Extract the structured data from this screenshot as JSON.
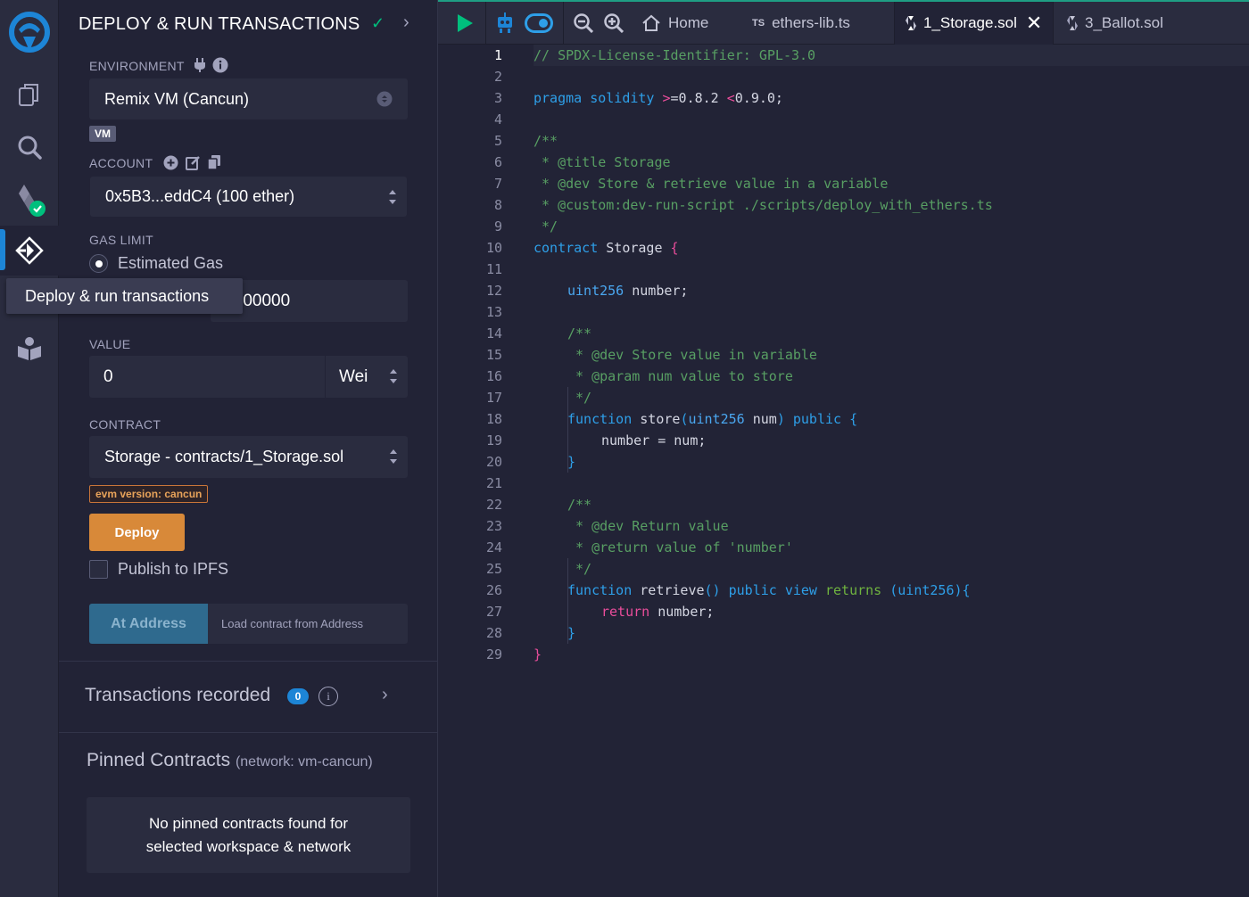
{
  "panel": {
    "title": "DEPLOY & RUN TRANSACTIONS",
    "environment_label": "ENVIRONMENT",
    "environment_value": "Remix VM (Cancun)",
    "vm_badge": "VM",
    "account_label": "ACCOUNT",
    "account_value": "0x5B3...eddC4 (100 ether)",
    "gas_limit_label": "GAS LIMIT",
    "estimated_gas_label": "Estimated Gas",
    "gas_limit_value": ")00000",
    "tooltip": "Deploy & run transactions",
    "value_label": "VALUE",
    "value_amount": "0",
    "value_unit": "Wei",
    "contract_label": "CONTRACT",
    "contract_value": "Storage - contracts/1_Storage.sol",
    "evm_badge": "evm version: cancun",
    "deploy_button": "Deploy",
    "publish_ipfs_label": "Publish to IPFS",
    "at_address_button": "At Address",
    "load_contract_placeholder": "Load contract from Address",
    "transactions_recorded_label": "Transactions recorded",
    "transactions_count": "0",
    "info_glyph": "i",
    "pinned_title": "Pinned Contracts",
    "pinned_network": "(network: vm-cancun)",
    "pinned_empty_line1": "No pinned contracts found for",
    "pinned_empty_line2": "selected workspace & network"
  },
  "iconbar": {
    "items": [
      "remix-logo-icon",
      "file-explorer-icon",
      "search-icon",
      "solidity-compiler-icon",
      "deploy-run-icon",
      "learneth-icon"
    ]
  },
  "editor": {
    "tabs": {
      "home": "Home",
      "ethers_prefix": "TS",
      "ethers": "ethers-lib.ts",
      "storage": "1_Storage.sol",
      "ballot": "3_Ballot.sol"
    },
    "line_numbers": [
      "1",
      "2",
      "3",
      "4",
      "5",
      "6",
      "7",
      "8",
      "9",
      "10",
      "11",
      "12",
      "13",
      "14",
      "15",
      "16",
      "17",
      "18",
      "19",
      "20",
      "21",
      "22",
      "23",
      "24",
      "25",
      "26",
      "27",
      "28",
      "29"
    ],
    "code": {
      "l1": "// SPDX-License-Identifier: GPL-3.0",
      "l3a": "pragma solidity",
      "l3b": ">",
      "l3c": "=0.8.2",
      "l3d": "<",
      "l3e": "0.9.0;",
      "l5": "/**",
      "l6": " * @title Storage",
      "l7": " * @dev Store & retrieve value in a variable",
      "l8": " * @custom:dev-run-script ./scripts/deploy_with_ethers.ts",
      "l9": " */",
      "l10a": "contract",
      "l10b": "Storage",
      "l10c": "{",
      "l12a": "uint256",
      "l12b": "number;",
      "l14": "/**",
      "l15": " * @dev Store value in variable",
      "l16": " * @param num value to store",
      "l17": " */",
      "l18a": "function",
      "l18b": "store",
      "l18c": "(",
      "l18d": "uint256",
      "l18e": "num",
      "l18f": ")",
      "l18g": "public",
      "l18h": "{",
      "l19": "number = num;",
      "l20": "}",
      "l22": "/**",
      "l23": " * @dev Return value",
      "l24": " * @return value of 'number'",
      "l25": " */",
      "l26a": "function",
      "l26b": "retrieve",
      "l26c": "()",
      "l26d": "public",
      "l26e": "view",
      "l26f": "returns",
      "l26g": "(uint256){",
      "l27a": "return",
      "l27b": "number;",
      "l28": "}",
      "l29": "}"
    }
  },
  "colors": {
    "accent": "#1d85d6",
    "deploy": "#d88939",
    "success": "#00bf7d",
    "comment": "#589f63",
    "keyword": "#2e9fe8"
  }
}
